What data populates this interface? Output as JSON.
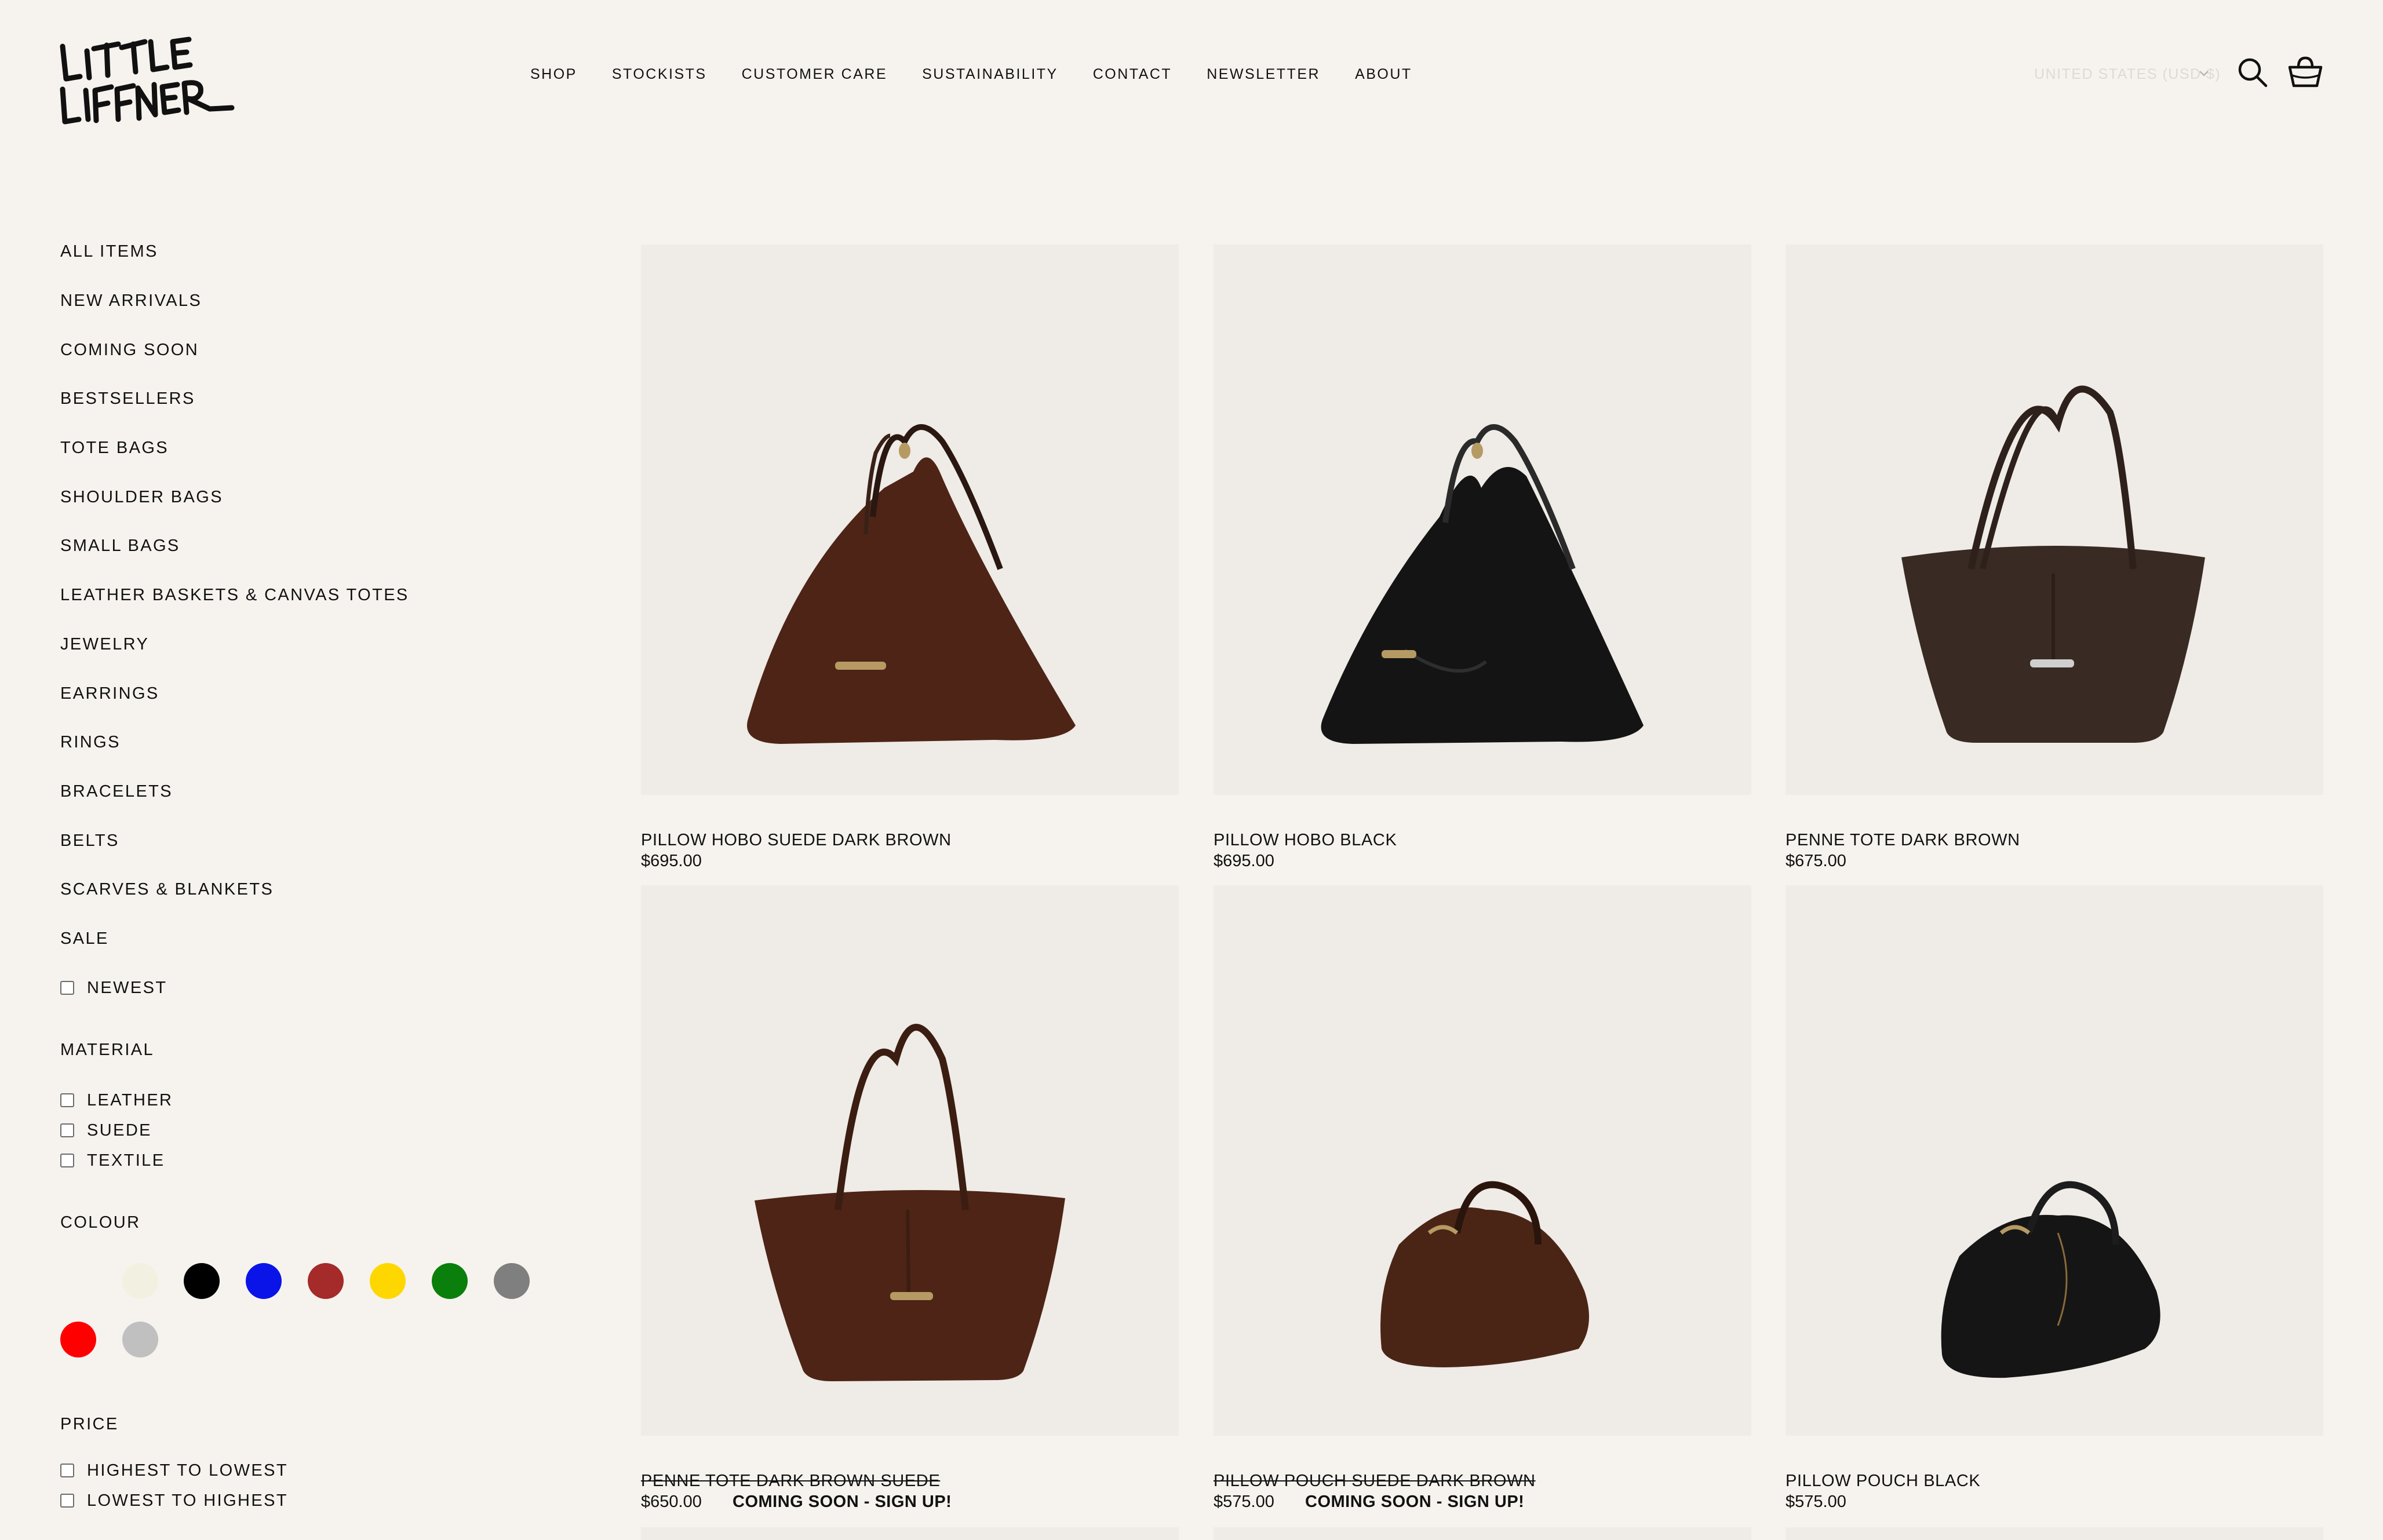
{
  "brand": {
    "logo_text": "LITTLE LIFFNER"
  },
  "nav": {
    "items": [
      "SHOP",
      "STOCKISTS",
      "CUSTOMER CARE",
      "SUSTAINABILITY",
      "CONTACT",
      "NEWSLETTER",
      "ABOUT"
    ]
  },
  "header": {
    "currency": "UNITED STATES (USD $)",
    "icons": {
      "search": "search-icon",
      "cart": "basket-icon",
      "currency": "chevron-down-icon"
    }
  },
  "sidebar": {
    "categories": [
      "ALL ITEMS",
      "NEW ARRIVALS",
      "COMING SOON",
      "BESTSELLERS",
      "TOTE BAGS",
      "SHOULDER BAGS",
      "SMALL BAGS",
      "LEATHER BASKETS & CANVAS TOTES",
      "JEWELRY",
      "EARRINGS",
      "RINGS",
      "BRACELETS",
      "BELTS",
      "SCARVES & BLANKETS",
      "SALE"
    ],
    "newest_label": "NEWEST",
    "material": {
      "heading": "MATERIAL",
      "options": [
        "LEATHER",
        "SUEDE",
        "TEXTILE"
      ]
    },
    "colour": {
      "heading": "COLOUR",
      "swatches": [
        "#f6f3ee",
        "#f2f1e1",
        "#000000",
        "#0a14e8",
        "#a52a2a",
        "#ffd700",
        "#0b7f0b",
        "#7f7f7f",
        "#ff0000",
        "#c0c0c0"
      ]
    },
    "price": {
      "heading": "PRICE",
      "options": [
        "HIGHEST TO LOWEST",
        "LOWEST TO HIGHEST"
      ]
    }
  },
  "products": [
    {
      "name": "PILLOW HOBO SUEDE DARK BROWN",
      "price": "$695.00",
      "badge": "",
      "strikethrough": false,
      "color": "#4d2416"
    },
    {
      "name": "PILLOW HOBO BLACK",
      "price": "$695.00",
      "badge": "",
      "strikethrough": false,
      "color": "#141414"
    },
    {
      "name": "PENNE TOTE DARK BROWN",
      "price": "$675.00",
      "badge": "",
      "strikethrough": false,
      "color": "#3a2a24"
    },
    {
      "name": "PENNE TOTE DARK BROWN SUEDE",
      "price": "$650.00",
      "badge": "COMING SOON - SIGN UP!",
      "strikethrough": true,
      "color": "#4d2416"
    },
    {
      "name": "PILLOW POUCH SUEDE DARK BROWN",
      "price": "$575.00",
      "badge": "COMING SOON - SIGN UP!",
      "strikethrough": true,
      "color": "#4a2516"
    },
    {
      "name": "PILLOW POUCH BLACK",
      "price": "$575.00",
      "badge": "",
      "strikethrough": false,
      "color": "#151515"
    }
  ]
}
